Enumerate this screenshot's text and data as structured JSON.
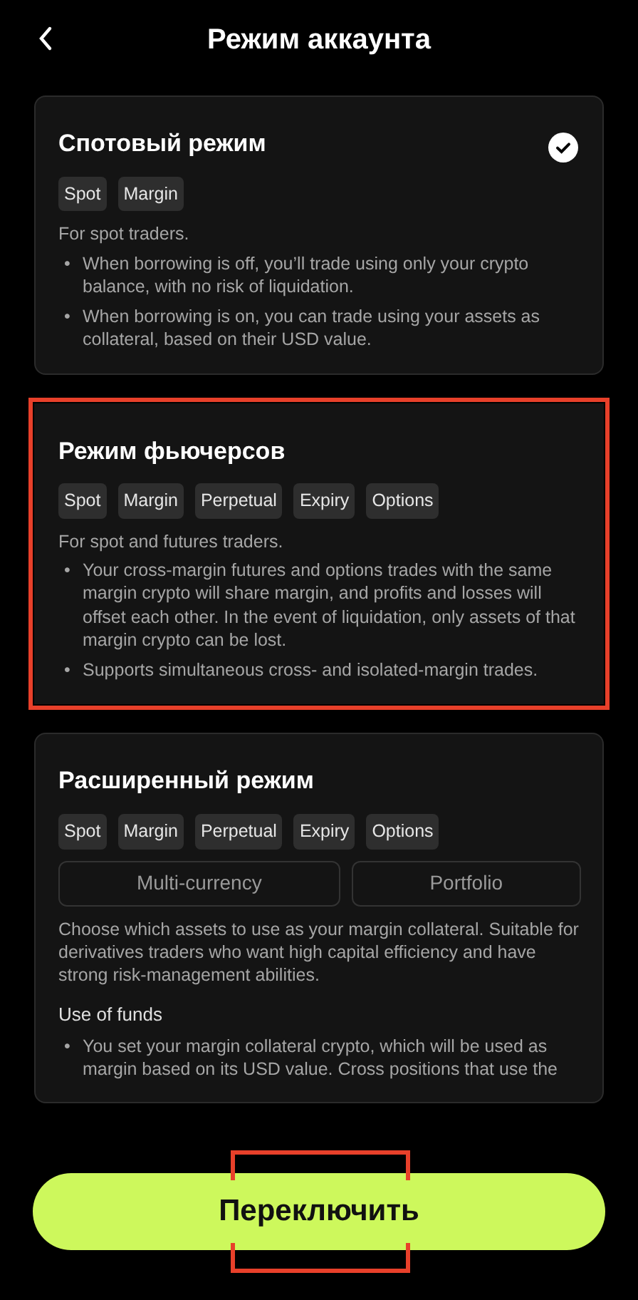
{
  "header": {
    "title": "Режим аккаунта"
  },
  "modes": [
    {
      "title": "Спотовый режим",
      "selected": true,
      "highlighted": false,
      "tags": [
        "Spot",
        "Margin"
      ],
      "description": "For spot traders.",
      "bullets": [
        {
          "marker": "•",
          "text": "When borrowing is off, you’ll trade using only your crypto balance, with no risk of liquidation."
        },
        {
          "marker": "•",
          "text": "When borrowing is on, you can trade using your assets as collateral, based on their USD value."
        }
      ]
    },
    {
      "title": "Режим фьючерсов",
      "selected": false,
      "highlighted": true,
      "tags": [
        "Spot",
        "Margin",
        "Perpetual",
        "Expiry",
        "Options"
      ],
      "description": "For spot and futures traders.",
      "bullets": [
        {
          "marker": "•",
          "text": "Your cross-margin futures and options trades with the same margin crypto will share margin, and profits and losses will offset each other. In the event of liquidation, only assets of that margin crypto can be lost."
        },
        {
          "marker": "•",
          "text": "Supports simultaneous cross- and isolated-margin trades."
        }
      ]
    },
    {
      "title": "Расширенный режим",
      "selected": false,
      "highlighted": false,
      "tags": [
        "Spot",
        "Margin",
        "Perpetual",
        "Expiry",
        "Options"
      ],
      "options": [
        "Multi-currency",
        "Portfolio"
      ],
      "description": "Choose which assets to use as your margin collateral. Suitable for derivatives traders who want high capital efficiency and have strong risk-management abilities.",
      "section_heading": "Use of funds",
      "bullets": [
        {
          "marker": "•",
          "text": "You set your margin collateral crypto, which will be used as margin based on its USD value. Cross positions that use the"
        }
      ]
    }
  ],
  "switch_button": {
    "label": "Переключить",
    "highlighted": true
  }
}
